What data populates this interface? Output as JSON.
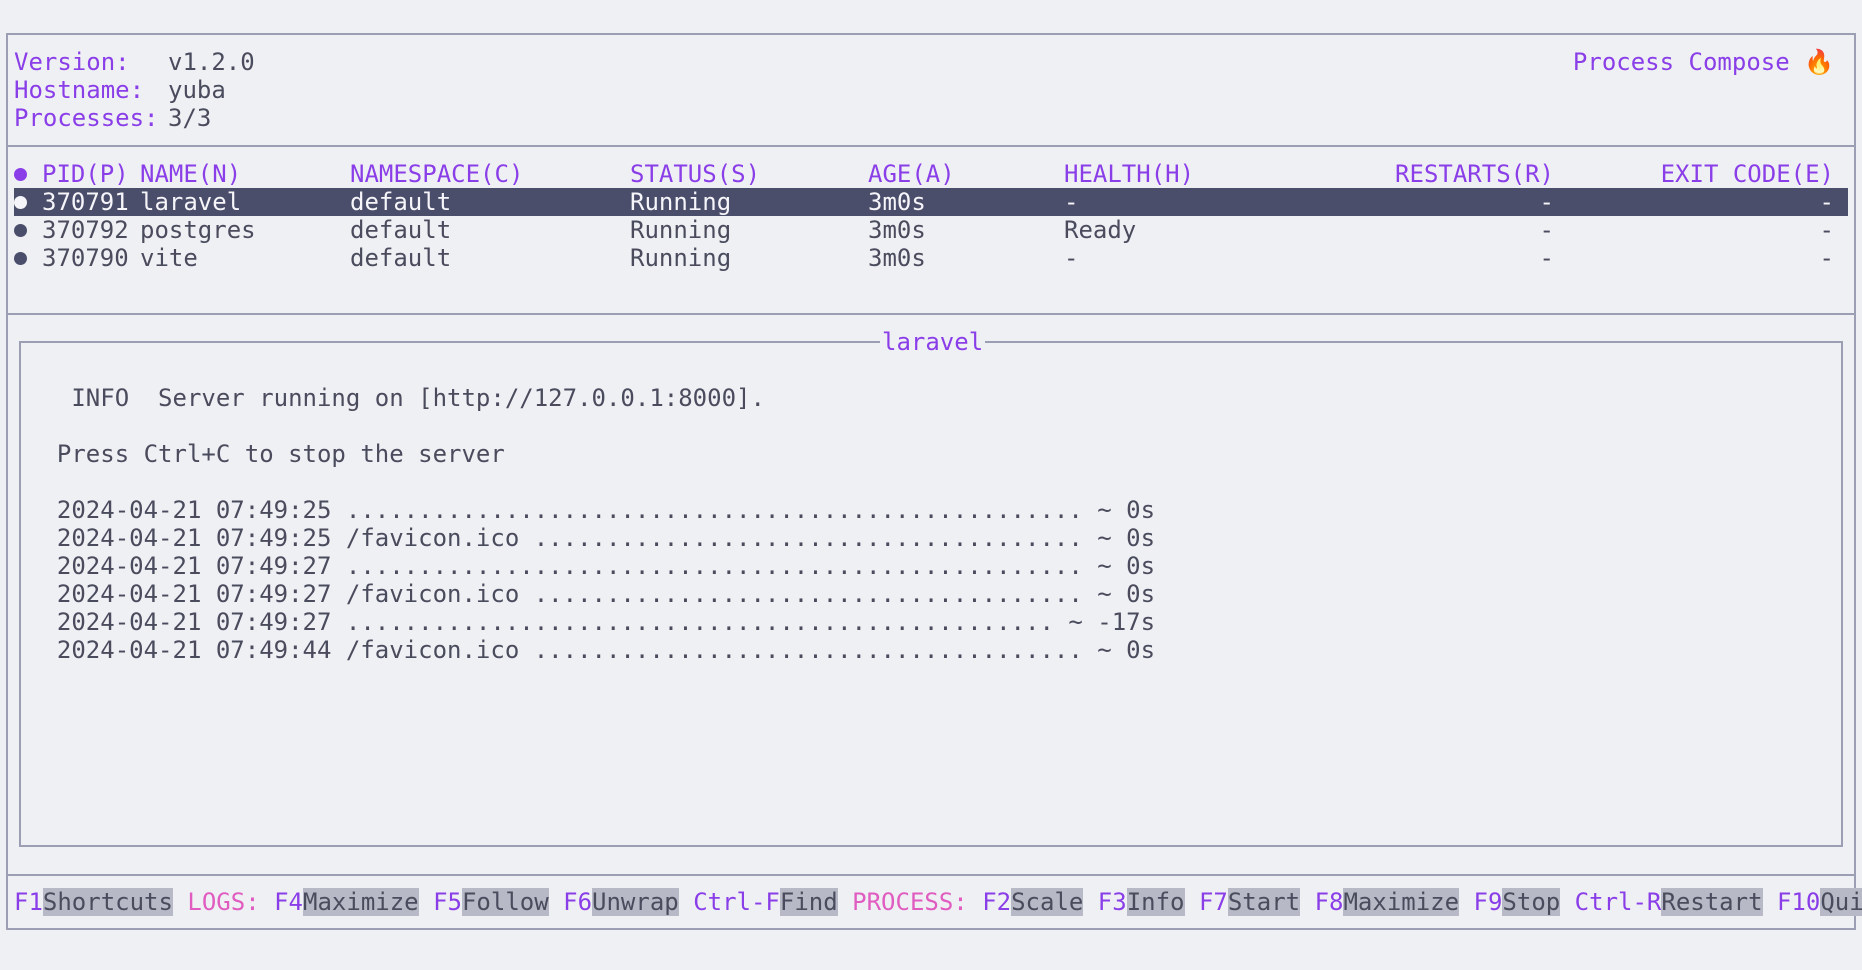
{
  "header": {
    "version_label": "Version:",
    "version_value": "v1.2.0",
    "hostname_label": "Hostname:",
    "hostname_value": "yuba",
    "processes_label": "Processes:",
    "processes_value": "3/3",
    "app_title": "Process Compose 🔥"
  },
  "table": {
    "columns": [
      "PID(P)",
      "NAME(N)",
      "NAMESPACE(C)",
      "STATUS(S)",
      "AGE(A)",
      "HEALTH(H)",
      "RESTARTS(R)",
      "EXIT CODE(E)"
    ],
    "rows": [
      {
        "pid": "370791",
        "name": "laravel",
        "namespace": "default",
        "status": "Running",
        "age": "3m0s",
        "health": "-",
        "restarts": "-",
        "exit_code": "-",
        "selected": true
      },
      {
        "pid": "370792",
        "name": "postgres",
        "namespace": "default",
        "status": "Running",
        "age": "3m0s",
        "health": "Ready",
        "restarts": "-",
        "exit_code": "-",
        "selected": false
      },
      {
        "pid": "370790",
        "name": "vite",
        "namespace": "default",
        "status": "Running",
        "age": "3m0s",
        "health": "-",
        "restarts": "-",
        "exit_code": "-",
        "selected": false
      }
    ]
  },
  "log": {
    "title": "laravel",
    "lines": [
      "   INFO  Server running on [http://127.0.0.1:8000].",
      "",
      "  Press Ctrl+C to stop the server",
      "",
      "  2024-04-21 07:49:25 ................................................... ~ 0s",
      "  2024-04-21 07:49:25 /favicon.ico ...................................... ~ 0s",
      "  2024-04-21 07:49:27 ................................................... ~ 0s",
      "  2024-04-21 07:49:27 /favicon.ico ...................................... ~ 0s",
      "  2024-04-21 07:49:27 ................................................. ~ -17s",
      "  2024-04-21 07:49:44 /favicon.ico ...................................... ~ 0s"
    ]
  },
  "footer": {
    "items": [
      {
        "type": "key",
        "key": "F1",
        "label": "Shortcuts"
      },
      {
        "type": "section",
        "label": "LOGS:"
      },
      {
        "type": "key",
        "key": "F4",
        "label": "Maximize"
      },
      {
        "type": "key",
        "key": "F5",
        "label": "Follow"
      },
      {
        "type": "key",
        "key": "F6",
        "label": "Unwrap"
      },
      {
        "type": "key",
        "key": "Ctrl-F",
        "label": "Find"
      },
      {
        "type": "section",
        "label": "PROCESS:"
      },
      {
        "type": "key",
        "key": "F2",
        "label": "Scale"
      },
      {
        "type": "key",
        "key": "F3",
        "label": "Info"
      },
      {
        "type": "key",
        "key": "F7",
        "label": "Start"
      },
      {
        "type": "key",
        "key": "F8",
        "label": "Maximize"
      },
      {
        "type": "key",
        "key": "F9",
        "label": "Stop"
      },
      {
        "type": "key",
        "key": "Ctrl-R",
        "label": "Restart"
      },
      {
        "type": "key",
        "key": "F10",
        "label": "Quit"
      }
    ]
  },
  "colors": {
    "background": "#eff0f4",
    "accent_purple": "#8a3ee8",
    "accent_pink": "#e05cc0",
    "selection": "#4b4e6a",
    "border": "#9c9fb3",
    "dot_default": "#4b4e6a",
    "dot_header": "#8a3ee8"
  }
}
